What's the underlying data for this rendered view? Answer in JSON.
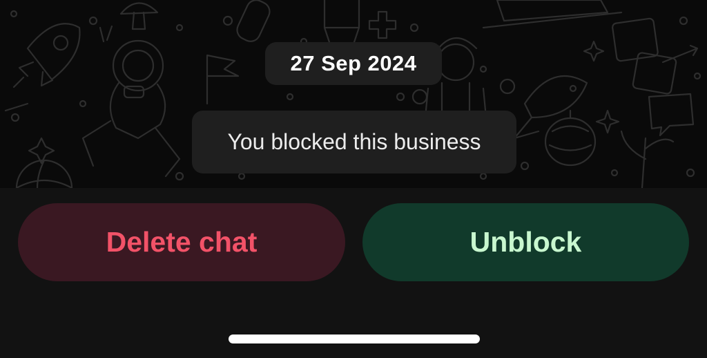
{
  "chat": {
    "date": "27 Sep 2024",
    "system_message": "You blocked this business"
  },
  "actions": {
    "delete_label": "Delete chat",
    "unblock_label": "Unblock"
  },
  "colors": {
    "delete_text": "#f25268",
    "delete_bg": "#3a1822",
    "unblock_text": "#c8f7cf",
    "unblock_bg": "#113a2b",
    "bubble_bg": "#1f1f1f",
    "background": "#0b0b0b"
  }
}
